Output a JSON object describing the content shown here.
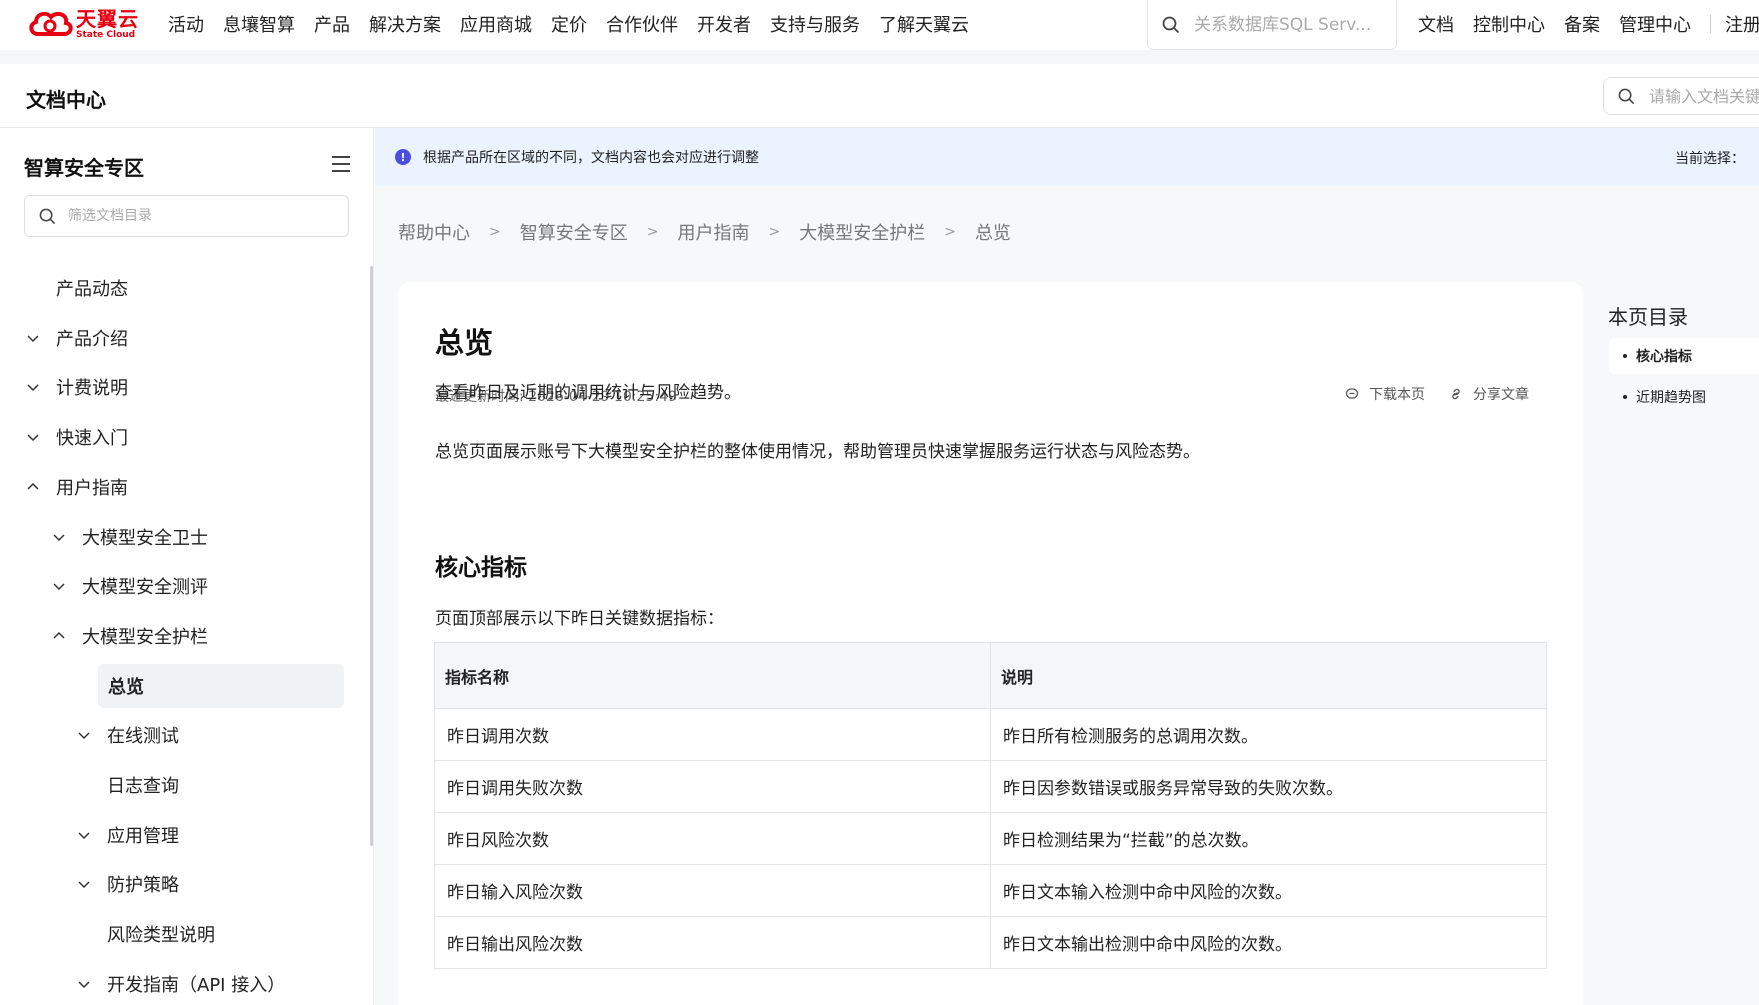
{
  "topnav": {
    "logo_cn": "天翼云",
    "logo_en": "State Cloud",
    "items": [
      "活动",
      "息壤智算",
      "产品",
      "解决方案",
      "应用商城",
      "定价",
      "合作伙伴",
      "开发者",
      "支持与服务",
      "了解天翼云"
    ],
    "search_placeholder": "关系数据库SQL Serv...",
    "right_items": [
      "文档",
      "控制中心",
      "备案",
      "管理中心"
    ],
    "register": "注册"
  },
  "doc_header": {
    "title": "文档中心",
    "search_placeholder": "请输入文档关键"
  },
  "sidebar": {
    "title": "智算安全专区",
    "search_placeholder": "筛选文档目录",
    "items": [
      {
        "label": "产品动态",
        "chevron": "none"
      },
      {
        "label": "产品介绍",
        "chevron": "down"
      },
      {
        "label": "计费说明",
        "chevron": "down"
      },
      {
        "label": "快速入门",
        "chevron": "down"
      },
      {
        "label": "用户指南",
        "chevron": "up"
      },
      {
        "label": "大模型安全卫士",
        "chevron": "down"
      },
      {
        "label": "大模型安全测评",
        "chevron": "down"
      },
      {
        "label": "大模型安全护栏",
        "chevron": "up"
      },
      {
        "label": "总览",
        "chevron": "none"
      },
      {
        "label": "在线测试",
        "chevron": "down"
      },
      {
        "label": "日志查询",
        "chevron": "none"
      },
      {
        "label": "应用管理",
        "chevron": "down"
      },
      {
        "label": "防护策略",
        "chevron": "down"
      },
      {
        "label": "风险类型说明",
        "chevron": "none"
      },
      {
        "label": "开发指南（API 接入）",
        "chevron": "down"
      }
    ]
  },
  "notice": {
    "icon": "!",
    "text": "根据产品所在区域的不同，文档内容也会对应进行调整",
    "right": "当前选择："
  },
  "breadcrumb": [
    "帮助中心",
    "智算安全专区",
    "用户指南",
    "大模型安全护栏",
    "总览"
  ],
  "article": {
    "title": "总览",
    "updated": "最近更新时间: 2026-04-29 10:25:49",
    "download": "下载本页",
    "share": "分享文章",
    "intro": "查看昨日及近期的调用统计与风险趋势。",
    "desc": "总览页面展示账号下大模型安全护栏的整体使用情况，帮助管理员快速掌握服务运行状态与风险态势。",
    "h2": "核心指标",
    "table_intro": "页面顶部展示以下昨日关键数据指标：",
    "table": {
      "headers": [
        "指标名称",
        "说明"
      ],
      "rows": [
        [
          "昨日调用次数",
          "昨日所有检测服务的总调用次数。"
        ],
        [
          "昨日调用失败次数",
          "昨日因参数错误或服务异常导致的失败次数。"
        ],
        [
          "昨日风险次数",
          "昨日检测结果为“拦截”的总次数。"
        ],
        [
          "昨日输入风险次数",
          "昨日文本输入检测中命中风险的次数。"
        ],
        [
          "昨日输出风险次数",
          "昨日文本输出检测中命中风险的次数。"
        ]
      ]
    }
  },
  "toc": {
    "title": "本页目录",
    "items": [
      "核心指标",
      "近期趋势图"
    ]
  },
  "colors": {
    "brand": "#e60012",
    "notice_bg": "#eaf3fe",
    "notice_icon": "#4a4fe0"
  }
}
